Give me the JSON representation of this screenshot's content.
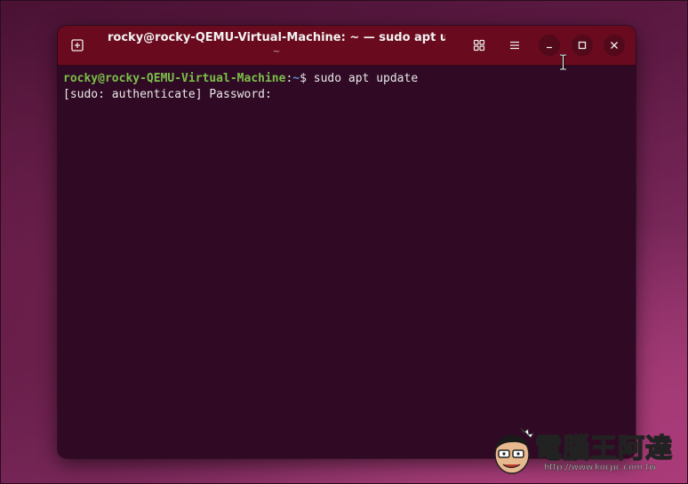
{
  "window": {
    "title": "rocky@rocky-QEMU-Virtual-Machine: ~ — sudo apt u...",
    "subtitle": "~"
  },
  "icons": {
    "new_tab": "new-tab-icon",
    "grid": "grid-view-icon",
    "menu": "hamburger-menu-icon",
    "minimize": "minimize-icon",
    "maximize": "maximize-icon",
    "close": "close-icon",
    "cursor": "text-cursor-icon"
  },
  "terminal": {
    "prompt_user": "rocky@rocky-QEMU-Virtual-Machine",
    "prompt_sep": ":",
    "prompt_path": "~",
    "prompt_symbol": "$ ",
    "command": "sudo apt update",
    "output_line": "[sudo: authenticate] Password:"
  },
  "colors": {
    "titlebar": "#6a0a1e",
    "terminal_bg": "#300a24",
    "prompt_user": "#7bbf4a",
    "prompt_path": "#5b8fd6",
    "text": "#e8e8e8"
  },
  "watermark": {
    "text": "電腦王阿達",
    "url": "http://www.kocpc.com.tw"
  }
}
